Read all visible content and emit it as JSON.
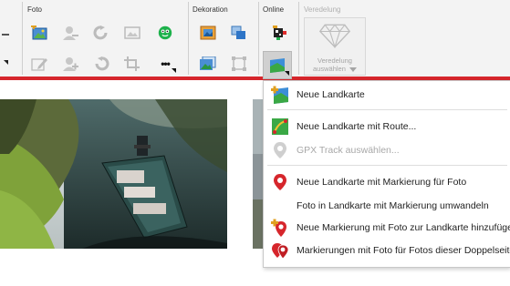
{
  "ribbon": {
    "groups": {
      "foto": "Foto",
      "dekoration": "Dekoration",
      "online": "Online",
      "veredelung": "Veredelung"
    },
    "veredelung_button": {
      "line1": "Veredelung",
      "line2": "auswählen"
    },
    "more_label": "•••",
    "accent_color": "#d6262c"
  },
  "menu": {
    "items": [
      {
        "label": "Neue Landkarte",
        "icon": "new-map-icon",
        "enabled": true
      },
      {
        "label": "Neue Landkarte mit Route...",
        "icon": "map-route-icon",
        "enabled": true
      },
      {
        "label": "GPX Track auswählen...",
        "icon": "gpx-track-icon",
        "enabled": false
      },
      {
        "label": "Neue Landkarte mit Markierung für Foto",
        "icon": "map-marker-icon",
        "enabled": true
      },
      {
        "label": "Foto in Landkarte mit Markierung umwandeln",
        "icon": "",
        "enabled": true
      },
      {
        "label": "Neue Markierung mit Foto zur Landkarte hinzufügen",
        "icon": "add-marker-icon",
        "enabled": true
      },
      {
        "label": "Markierungen mit Foto für Fotos dieser Doppelseite",
        "icon": "multi-marker-icon",
        "enabled": true
      }
    ]
  }
}
